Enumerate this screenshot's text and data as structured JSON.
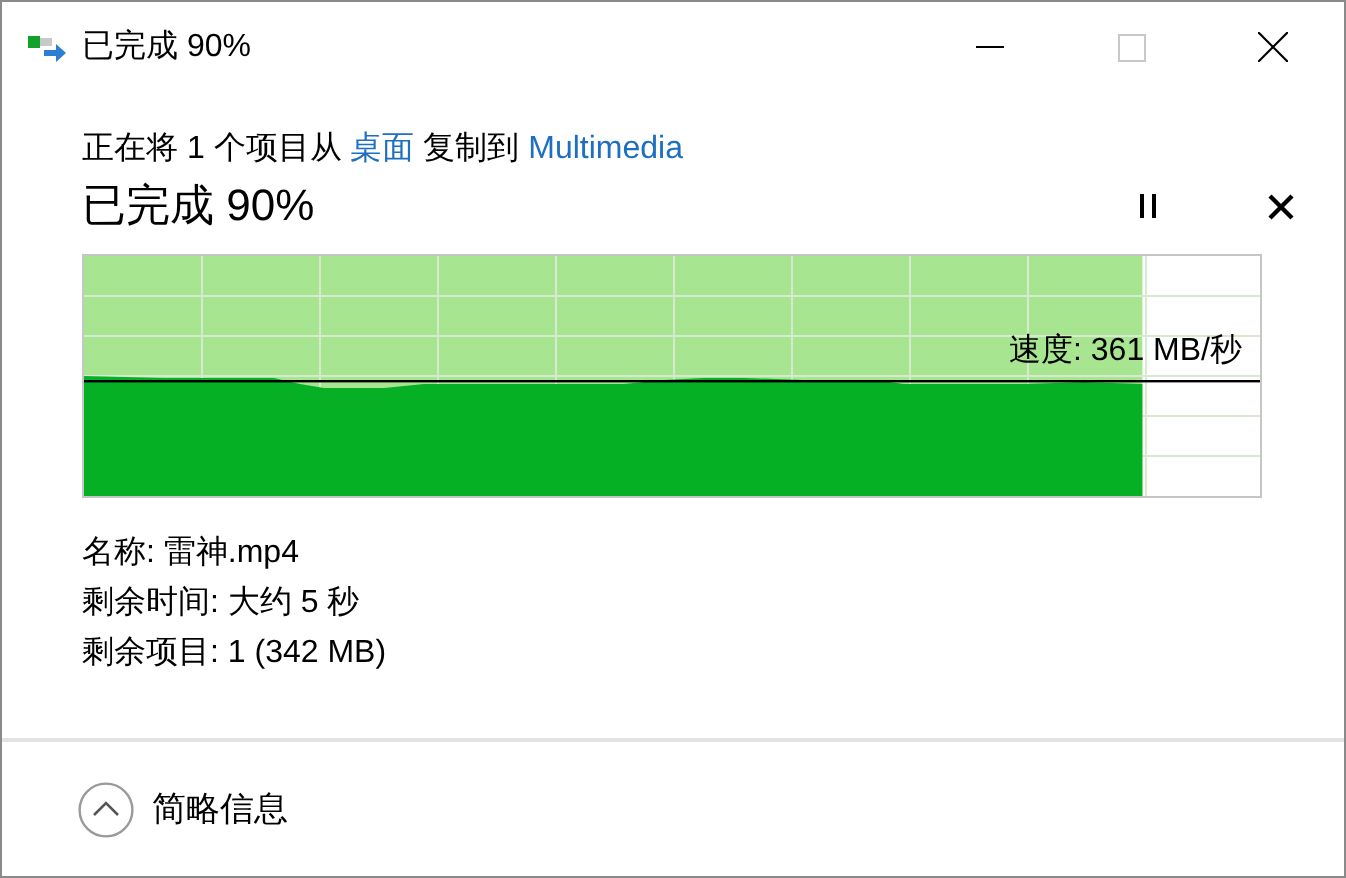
{
  "window": {
    "title": "已完成 90%",
    "controls": [
      {
        "kind": "minimize",
        "disabled": false
      },
      {
        "kind": "maximize",
        "disabled": true
      },
      {
        "kind": "close",
        "disabled": false
      }
    ]
  },
  "description": [
    {
      "kind": "text",
      "text": "正在将 1 个项目从 "
    },
    {
      "kind": "link",
      "text": "桌面"
    },
    {
      "kind": "text",
      "text": " 复制到 "
    },
    {
      "kind": "link",
      "text": "Multimedia"
    }
  ],
  "status": {
    "heading": "已完成 90%",
    "buttons": [
      {
        "kind": "pause"
      },
      {
        "kind": "cancel"
      }
    ]
  },
  "progress": {
    "level": 0.9,
    "speed": "速度: 361 MB/秒"
  },
  "details": [
    "名称: 雷神.mp4",
    "剩余时间: 大约 5 秒",
    "剩余项目: 1 (342 MB)"
  ],
  "footer": {
    "label": "简略信息"
  }
}
